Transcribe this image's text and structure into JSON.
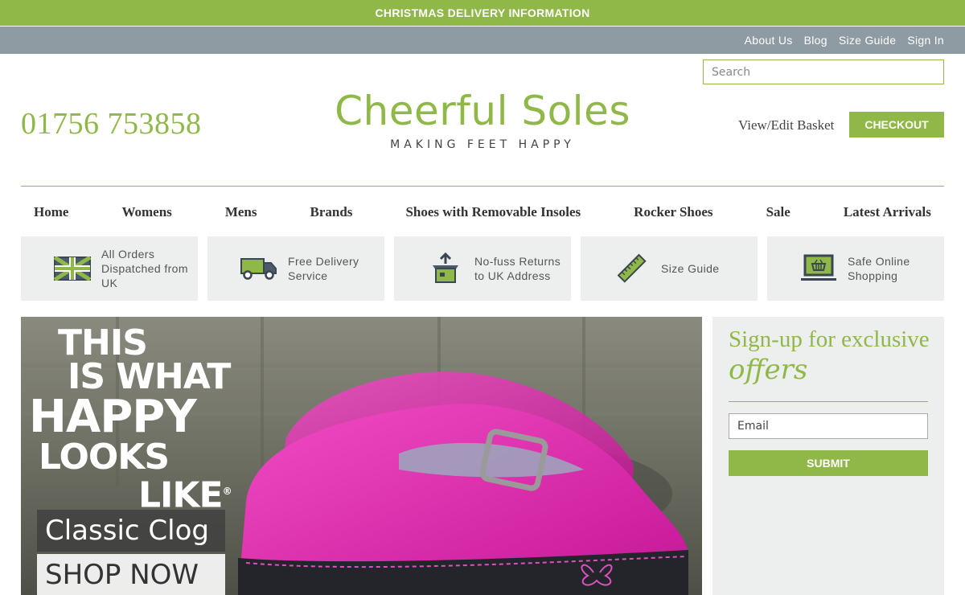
{
  "topbar": {
    "label": "CHRISTMAS DELIVERY INFORMATION"
  },
  "utility_links": [
    "About Us",
    "Blog",
    "Size Guide",
    "Sign In"
  ],
  "search": {
    "placeholder": "Search",
    "value": ""
  },
  "phone": "01756 753858",
  "logo": {
    "name": "Cheerful Soles",
    "tagline": "MAKING FEET HAPPY"
  },
  "basket": {
    "link_label": "View/Edit Basket",
    "checkout_label": "CHECKOUT"
  },
  "nav": [
    "Home",
    "Womens",
    "Mens",
    "Brands",
    "Shoes with Removable Insoles",
    "Rocker Shoes",
    "Sale",
    "Latest Arrivals"
  ],
  "features": [
    {
      "icon": "uk-flag-icon",
      "text": "All Orders Dispatched from UK"
    },
    {
      "icon": "delivery-truck-icon",
      "text": "Free Delivery Service"
    },
    {
      "icon": "returns-box-icon",
      "text": "No-fuss Returns to UK Address"
    },
    {
      "icon": "ruler-icon",
      "text": "Size Guide"
    },
    {
      "icon": "laptop-basket-icon",
      "text": "Safe Online Shopping"
    }
  ],
  "hero": {
    "lines": [
      "THIS",
      "IS WHAT",
      "HAPPY",
      "LOOKS",
      "LIKE"
    ],
    "registered": "®",
    "product": "Classic Clog",
    "cta": "SHOP NOW"
  },
  "signup": {
    "title": "Sign-up for exclusive",
    "title_script": "offers",
    "email_placeholder": "Email",
    "submit_label": "SUBMIT"
  },
  "colors": {
    "brand_green": "#8fb848",
    "util_grey": "#8e9ba3",
    "panel_grey": "#edeeee",
    "shoe_pink": "#e020a8"
  }
}
